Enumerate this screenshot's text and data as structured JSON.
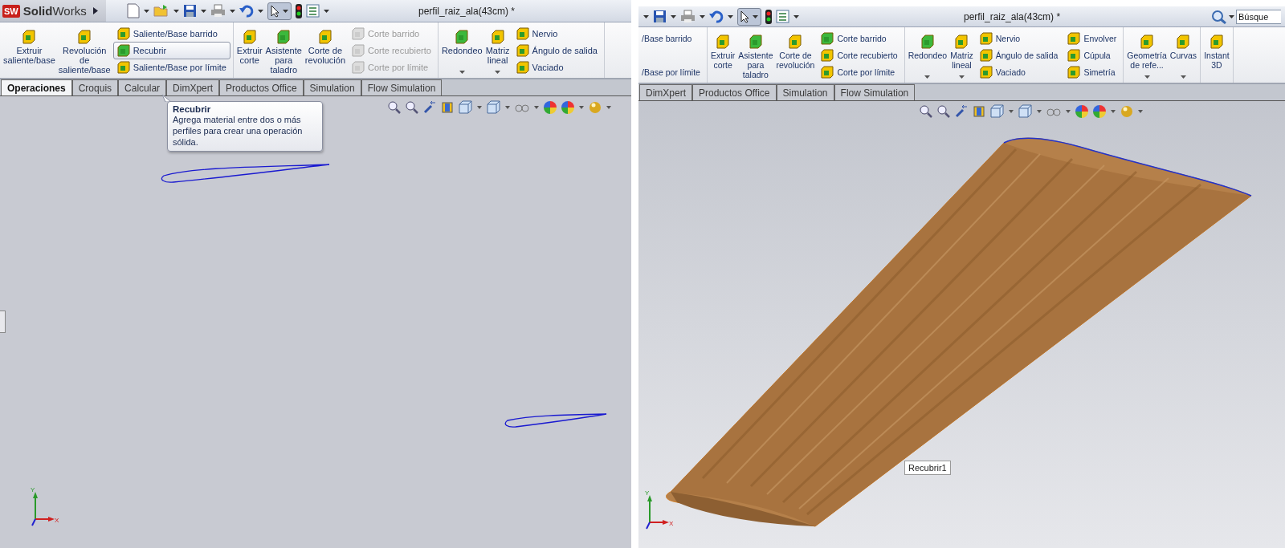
{
  "windows": [
    {
      "logo": {
        "badge": "SW",
        "name": "**Solid**Works"
      },
      "title": "perfil_raiz_ala(43cm) *",
      "viewport": {
        "kind": "sketch"
      },
      "ribbon": [
        {
          "items": [
            {
              "kind": "large",
              "lines": [
                "Extruir",
                "saliente/base"
              ],
              "dropdown": false
            },
            {
              "kind": "large",
              "lines": [
                "Revolución",
                "de",
                "saliente/base"
              ],
              "dropdown": false
            },
            {
              "kind": "stack",
              "items": [
                {
                  "label": "Saliente/Base barrido",
                  "disabled": false,
                  "highlighted": false
                },
                {
                  "label": "Recubrir",
                  "disabled": false,
                  "highlighted": true
                },
                {
                  "label": "Saliente/Base por límite",
                  "disabled": false,
                  "highlighted": false
                }
              ]
            }
          ]
        },
        {
          "items": [
            {
              "kind": "large",
              "lines": [
                "Extruir",
                "corte"
              ],
              "dropdown": false
            },
            {
              "kind": "large",
              "lines": [
                "Asistente",
                "para",
                "taladro"
              ],
              "dropdown": false
            },
            {
              "kind": "large",
              "lines": [
                "Corte de",
                "revolución"
              ],
              "dropdown": false
            },
            {
              "kind": "stack",
              "items": [
                {
                  "label": "Corte barrido",
                  "disabled": true,
                  "highlighted": false
                },
                {
                  "label": "Corte recubierto",
                  "disabled": true,
                  "highlighted": false
                },
                {
                  "label": "Corte por límite",
                  "disabled": true,
                  "highlighted": false
                }
              ]
            }
          ]
        },
        {
          "items": [
            {
              "kind": "large",
              "lines": [
                "Redondeo"
              ],
              "dropdown": true
            },
            {
              "kind": "large",
              "lines": [
                "Matriz",
                "lineal"
              ],
              "dropdown": true
            },
            {
              "kind": "stack",
              "items": [
                {
                  "label": "Nervio",
                  "disabled": false,
                  "highlighted": false
                },
                {
                  "label": "Ángulo de salida",
                  "disabled": false,
                  "highlighted": false
                },
                {
                  "label": "Vaciado",
                  "disabled": false,
                  "highlighted": false
                }
              ]
            }
          ]
        }
      ],
      "tabs": [
        {
          "label": "Operaciones",
          "selected": true
        },
        {
          "label": "Croquis",
          "selected": false
        },
        {
          "label": "Calcular",
          "selected": false
        },
        {
          "label": "DimXpert",
          "selected": false
        },
        {
          "label": "Productos Office",
          "selected": false
        },
        {
          "label": "Simulation",
          "selected": false
        },
        {
          "label": "Flow Simulation",
          "selected": false
        }
      ],
      "tooltip": {
        "title": "Recubrir",
        "text": "Agrega material entre dos o más perfiles para crear una operación sólida."
      },
      "triad": [
        "Y",
        "X"
      ]
    },
    {
      "title": "perfil_raiz_ala(43cm) *",
      "search": {
        "placeholder": "Búsque"
      },
      "viewport": {
        "kind": "shaded"
      },
      "ribbon": [
        {
          "items": [
            {
              "kind": "cut_stack",
              "items": [
                {
                  "label": "/Base barrido"
                },
                {
                  "label": "/Base por límite"
                }
              ]
            }
          ]
        },
        {
          "items": [
            {
              "kind": "large",
              "lines": [
                "Extruir",
                "corte"
              ],
              "dropdown": false
            },
            {
              "kind": "large",
              "lines": [
                "Asistente",
                "para",
                "taladro"
              ],
              "dropdown": false
            },
            {
              "kind": "large",
              "lines": [
                "Corte de",
                "revolución"
              ],
              "dropdown": false
            },
            {
              "kind": "stack",
              "items": [
                {
                  "label": "Corte barrido",
                  "disabled": false,
                  "highlighted": false
                },
                {
                  "label": "Corte recubierto",
                  "disabled": false,
                  "highlighted": false
                },
                {
                  "label": "Corte por límite",
                  "disabled": false,
                  "highlighted": false
                }
              ]
            }
          ]
        },
        {
          "items": [
            {
              "kind": "large",
              "lines": [
                "Redondeo"
              ],
              "dropdown": true
            },
            {
              "kind": "large",
              "lines": [
                "Matriz",
                "lineal"
              ],
              "dropdown": true
            },
            {
              "kind": "stack",
              "items": [
                {
                  "label": "Nervio",
                  "disabled": false,
                  "highlighted": false
                },
                {
                  "label": "Ángulo de salida",
                  "disabled": false,
                  "highlighted": false
                },
                {
                  "label": "Vaciado",
                  "disabled": false,
                  "highlighted": false
                }
              ]
            },
            {
              "kind": "stack",
              "items": [
                {
                  "label": "Envolver",
                  "disabled": false,
                  "highlighted": false
                },
                {
                  "label": "Cúpula",
                  "disabled": false,
                  "highlighted": false
                },
                {
                  "label": "Simetría",
                  "disabled": false,
                  "highlighted": false
                }
              ]
            }
          ]
        },
        {
          "items": [
            {
              "kind": "large",
              "lines": [
                "Geometría",
                "de refe..."
              ],
              "dropdown": true
            },
            {
              "kind": "large",
              "lines": [
                "Curvas"
              ],
              "dropdown": true
            }
          ]
        },
        {
          "items": [
            {
              "kind": "large",
              "lines": [
                "Instant",
                "3D"
              ],
              "dropdown": false
            }
          ]
        }
      ],
      "tabs": [
        {
          "label": "DimXpert",
          "selected": false
        },
        {
          "label": "Productos Office",
          "selected": false
        },
        {
          "label": "Simulation",
          "selected": false
        },
        {
          "label": "Flow Simulation",
          "selected": false
        }
      ],
      "model_label": "Recubrir1",
      "triad": [
        "Y",
        "X"
      ]
    }
  ]
}
